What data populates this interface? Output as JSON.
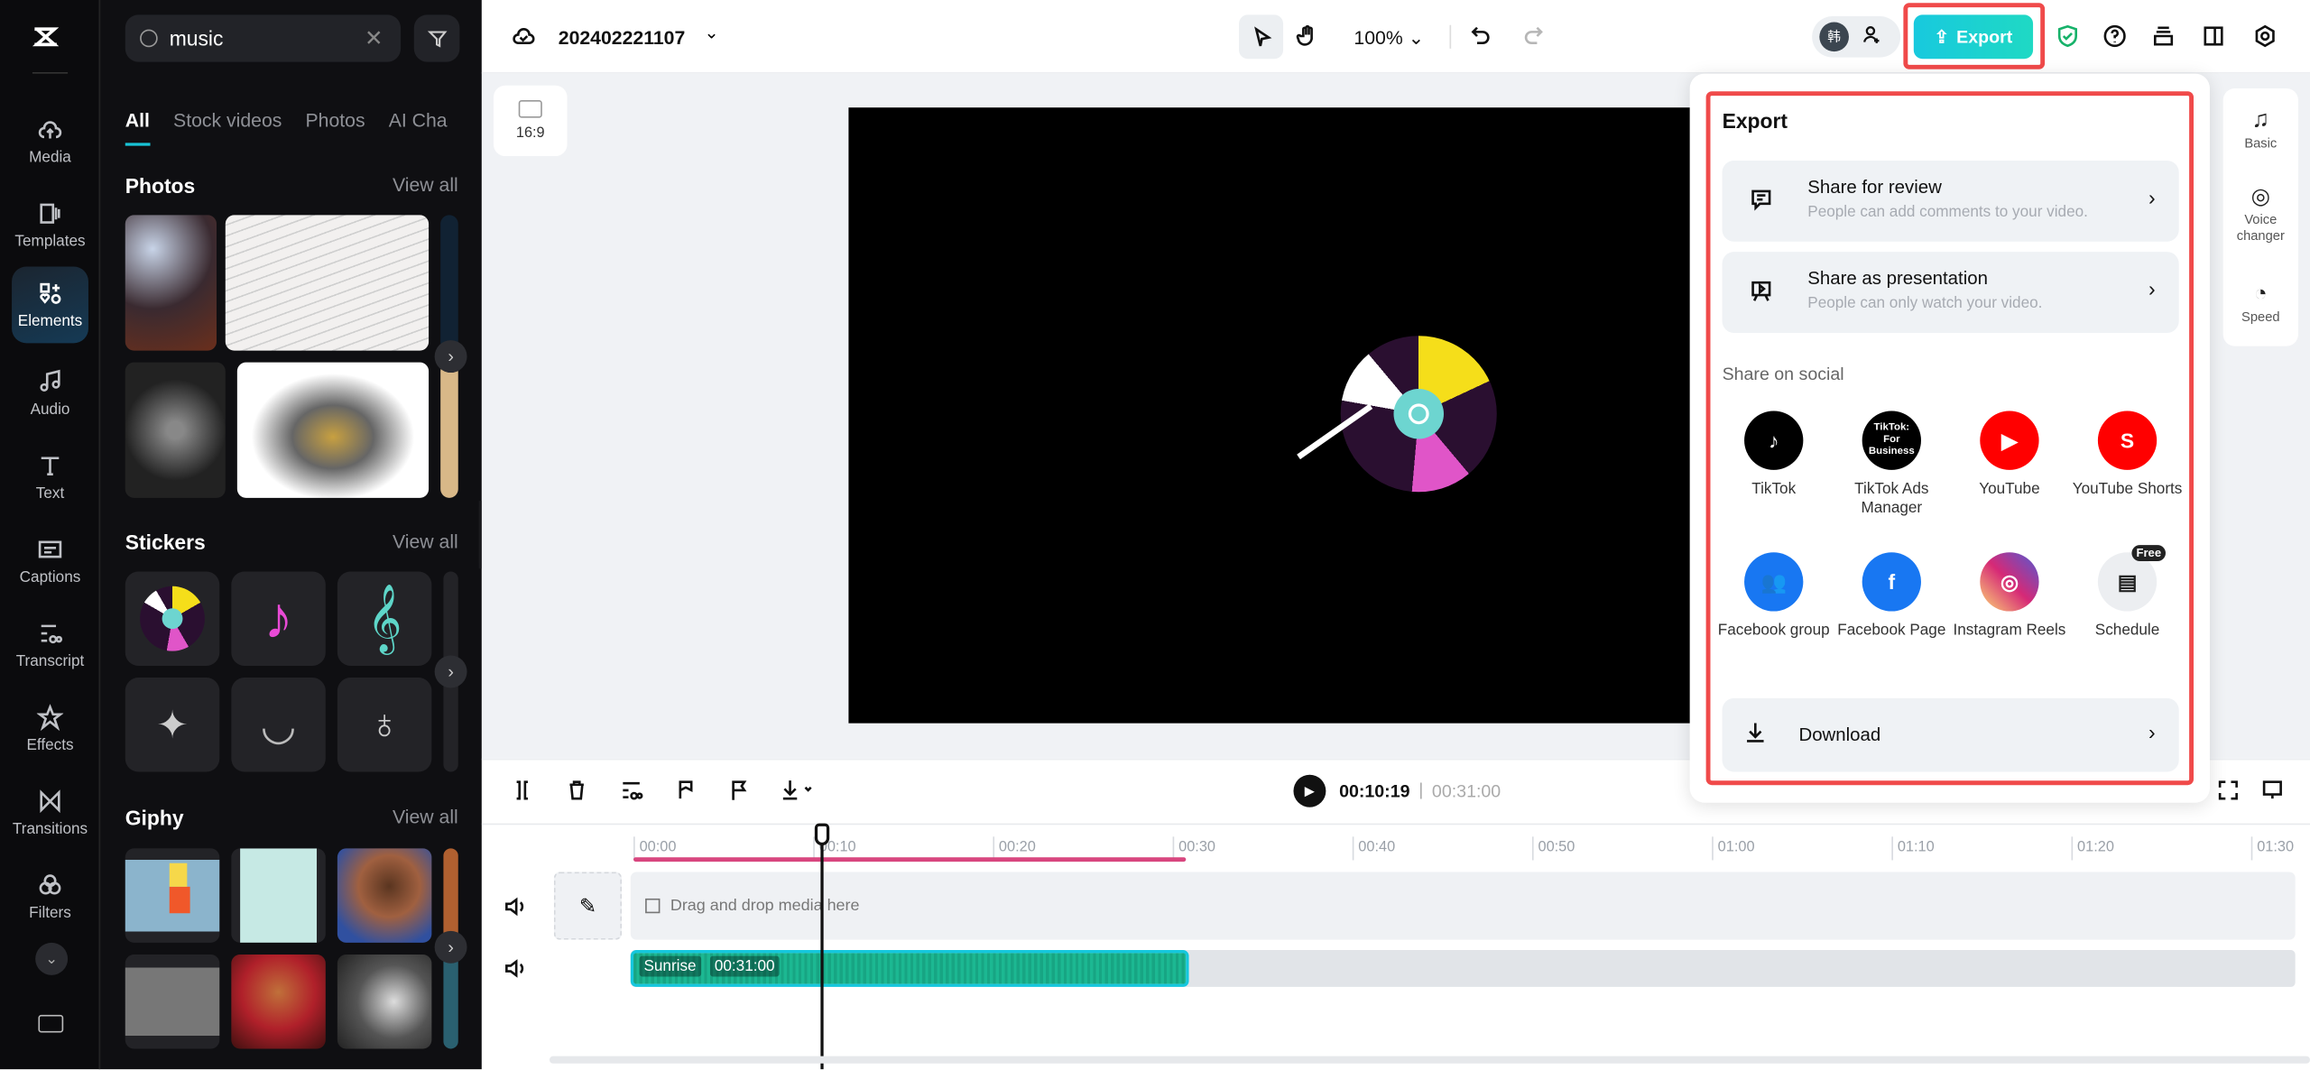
{
  "rail": {
    "items": [
      {
        "label": "Media",
        "icon": "cloud-upload-icon"
      },
      {
        "label": "Templates",
        "icon": "templates-icon"
      },
      {
        "label": "Elements",
        "icon": "elements-icon",
        "active": true
      },
      {
        "label": "Audio",
        "icon": "music-note-icon"
      },
      {
        "label": "Text",
        "icon": "text-icon"
      },
      {
        "label": "Captions",
        "icon": "captions-icon"
      },
      {
        "label": "Transcript",
        "icon": "transcript-icon"
      },
      {
        "label": "Effects",
        "icon": "effects-star-icon"
      },
      {
        "label": "Transitions",
        "icon": "transitions-icon"
      },
      {
        "label": "Filters",
        "icon": "filters-icon"
      }
    ]
  },
  "panel": {
    "search": {
      "value": "music"
    },
    "tabs": [
      "All",
      "Stock videos",
      "Photos",
      "AI Cha"
    ],
    "sections": [
      {
        "title": "Photos",
        "view_all": "View all"
      },
      {
        "title": "Stickers",
        "view_all": "View all"
      },
      {
        "title": "Giphy",
        "view_all": "View all"
      }
    ]
  },
  "topbar": {
    "project_name": "202402221107",
    "zoom": "100%",
    "export_label": "Export",
    "accent": "#1ccfd6"
  },
  "canvas": {
    "ratio": "16:9"
  },
  "export_menu": {
    "title": "Export",
    "options": [
      {
        "title": "Share for review",
        "subtitle": "People can add comments to your video."
      },
      {
        "title": "Share as presentation",
        "subtitle": "People can only watch your video."
      }
    ],
    "social_heading": "Share on social",
    "social": [
      {
        "label": "TikTok",
        "color": "#000000"
      },
      {
        "label": "TikTok Ads Manager",
        "color": "#000000",
        "badge": "TikTok: For Business"
      },
      {
        "label": "YouTube",
        "color": "#ff0000"
      },
      {
        "label": "YouTube Shorts",
        "color": "#ff0000"
      },
      {
        "label": "Facebook group",
        "color": "#1877f2"
      },
      {
        "label": "Facebook Page",
        "color": "#1877f2"
      },
      {
        "label": "Instagram Reels",
        "color": "#d62976"
      },
      {
        "label": "Schedule",
        "color": "#eceef1",
        "tag": "Free"
      }
    ],
    "download": "Download"
  },
  "right_panel": [
    {
      "label": "Basic"
    },
    {
      "label": "Voice changer"
    },
    {
      "label": "Speed"
    }
  ],
  "timeline": {
    "current_time": "00:10:19",
    "total_time": "00:31:00",
    "ruler": [
      "00:00",
      "00:10",
      "00:20",
      "00:30",
      "00:40",
      "00:50",
      "01:00",
      "01:10",
      "01:20",
      "01:30"
    ],
    "drop_hint": "Drag and drop media here",
    "clip": {
      "name": "Sunrise",
      "duration": "00:31:00"
    }
  }
}
